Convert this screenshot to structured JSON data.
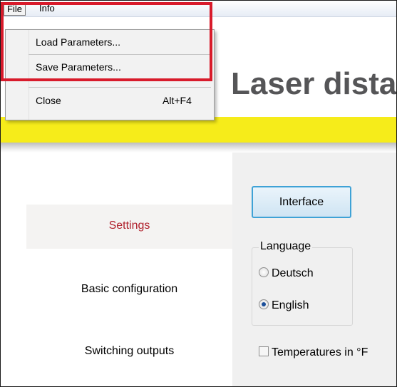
{
  "menubar": {
    "file": "File",
    "info": "Info"
  },
  "file_menu": {
    "items": [
      {
        "label": "Load Parameters...",
        "shortcut": ""
      },
      {
        "label": "Save Parameters...",
        "shortcut": ""
      },
      {
        "label": "Close",
        "shortcut": "Alt+F4"
      }
    ]
  },
  "header": {
    "title": "Laser dista"
  },
  "colors": {
    "accent_band": "#f6ec1a",
    "highlight_box": "#d81b2b",
    "selected_nav_text": "#b0202c",
    "button_border": "#3fa2d6"
  },
  "nav": {
    "items": [
      {
        "label": "Settings",
        "selected": true
      },
      {
        "label": "Basic configuration",
        "selected": false
      },
      {
        "label": "Switching outputs",
        "selected": false
      }
    ]
  },
  "settings": {
    "interface_button": "Interface",
    "language": {
      "legend": "Language",
      "options": [
        {
          "label": "Deutsch",
          "checked": false
        },
        {
          "label": "English",
          "checked": true
        }
      ]
    },
    "temperature_checkbox": {
      "label": "Temperatures in °F",
      "checked": false
    }
  }
}
